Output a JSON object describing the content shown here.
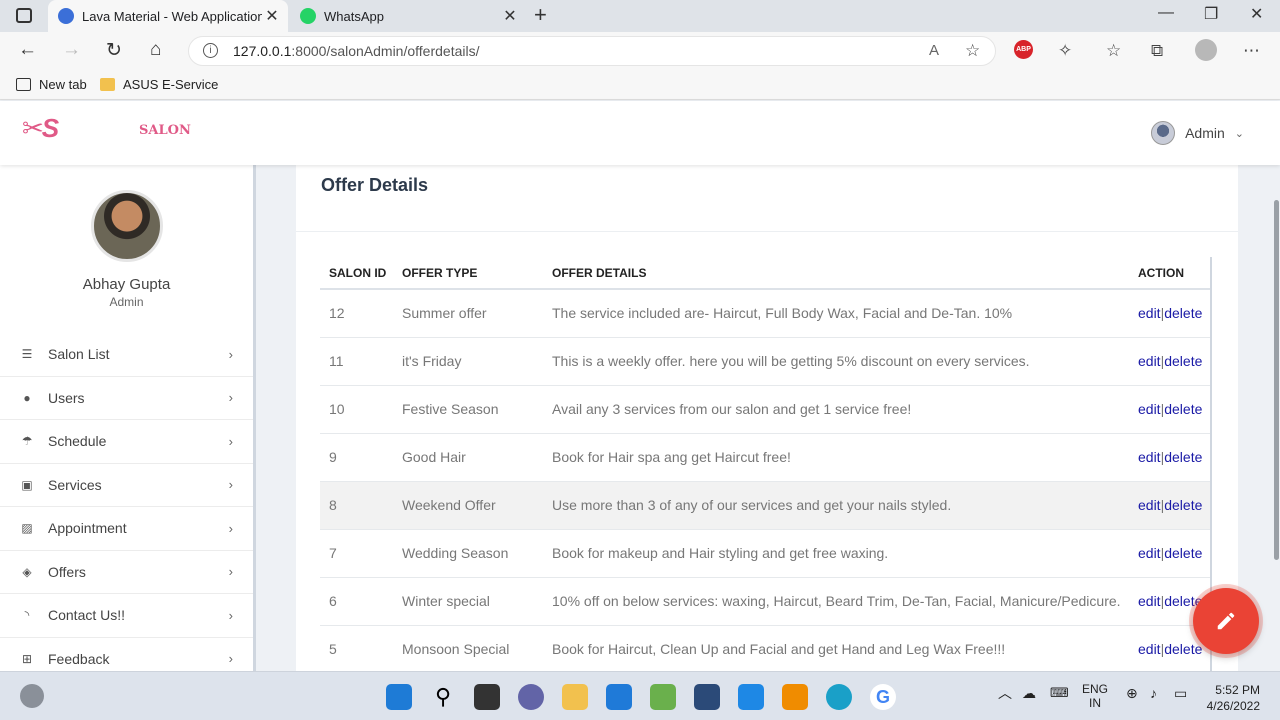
{
  "browser": {
    "tabs": [
      {
        "title": "Lava Material - Web Application",
        "active": true
      },
      {
        "title": "WhatsApp",
        "active": false
      }
    ],
    "url_host": "127.0.0.1",
    "url_path": ":8000/salonAdmin/offerdetails/",
    "bookmarks": [
      "New tab",
      "ASUS E-Service"
    ],
    "abp_label": "ABP"
  },
  "header": {
    "logo_mark": "✂S",
    "logo_text": "SALON",
    "admin_label": "Admin"
  },
  "sidebar": {
    "user_name": "Abhay Gupta",
    "user_role": "Admin",
    "items": [
      {
        "label": "Salon List",
        "icon": "list-icon"
      },
      {
        "label": "Users",
        "icon": "user-icon"
      },
      {
        "label": "Schedule",
        "icon": "umbrella-icon"
      },
      {
        "label": "Services",
        "icon": "save-icon"
      },
      {
        "label": "Appointment",
        "icon": "image-icon"
      },
      {
        "label": "Offers",
        "icon": "tags-icon"
      },
      {
        "label": "Contact Us!!",
        "icon": "rss-icon"
      },
      {
        "label": "Feedback",
        "icon": "plus-square-icon"
      }
    ]
  },
  "main": {
    "title": "Offer Details",
    "columns": [
      "SALON ID",
      "OFFER TYPE",
      "OFFER DETAILS",
      "ACTION"
    ],
    "rows": [
      {
        "id": "12",
        "type": "Summer offer",
        "details": "The service included are- Haircut, Full Body Wax, Facial and De-Tan. 10%"
      },
      {
        "id": "11",
        "type": "it's Friday",
        "details": "This is a weekly offer. here you will be getting 5% discount on every services."
      },
      {
        "id": "10",
        "type": "Festive Season",
        "details": "Avail any 3 services from our salon and get 1 service free!"
      },
      {
        "id": "9",
        "type": "Good Hair",
        "details": "Book for Hair spa ang get Haircut free!"
      },
      {
        "id": "8",
        "type": "Weekend Offer",
        "details": "Use more than 3 of any of our services and get your nails styled."
      },
      {
        "id": "7",
        "type": "Wedding Season",
        "details": "Book for makeup and Hair styling and get free waxing."
      },
      {
        "id": "6",
        "type": "Winter special",
        "details": "10% off on below services: waxing, Haircut, Beard Trim, De-Tan, Facial, Manicure/Pedicure."
      },
      {
        "id": "5",
        "type": "Monsoon Special",
        "details": "Book for Haircut, Clean Up and Facial and get Hand and Leg Wax Free!!!"
      }
    ],
    "action_edit": "edit",
    "action_sep": "|",
    "action_delete": "delete"
  },
  "taskbar": {
    "lang_top": "ENG",
    "lang_bottom": "IN",
    "time": "5:52 PM",
    "date": "4/26/2022"
  }
}
